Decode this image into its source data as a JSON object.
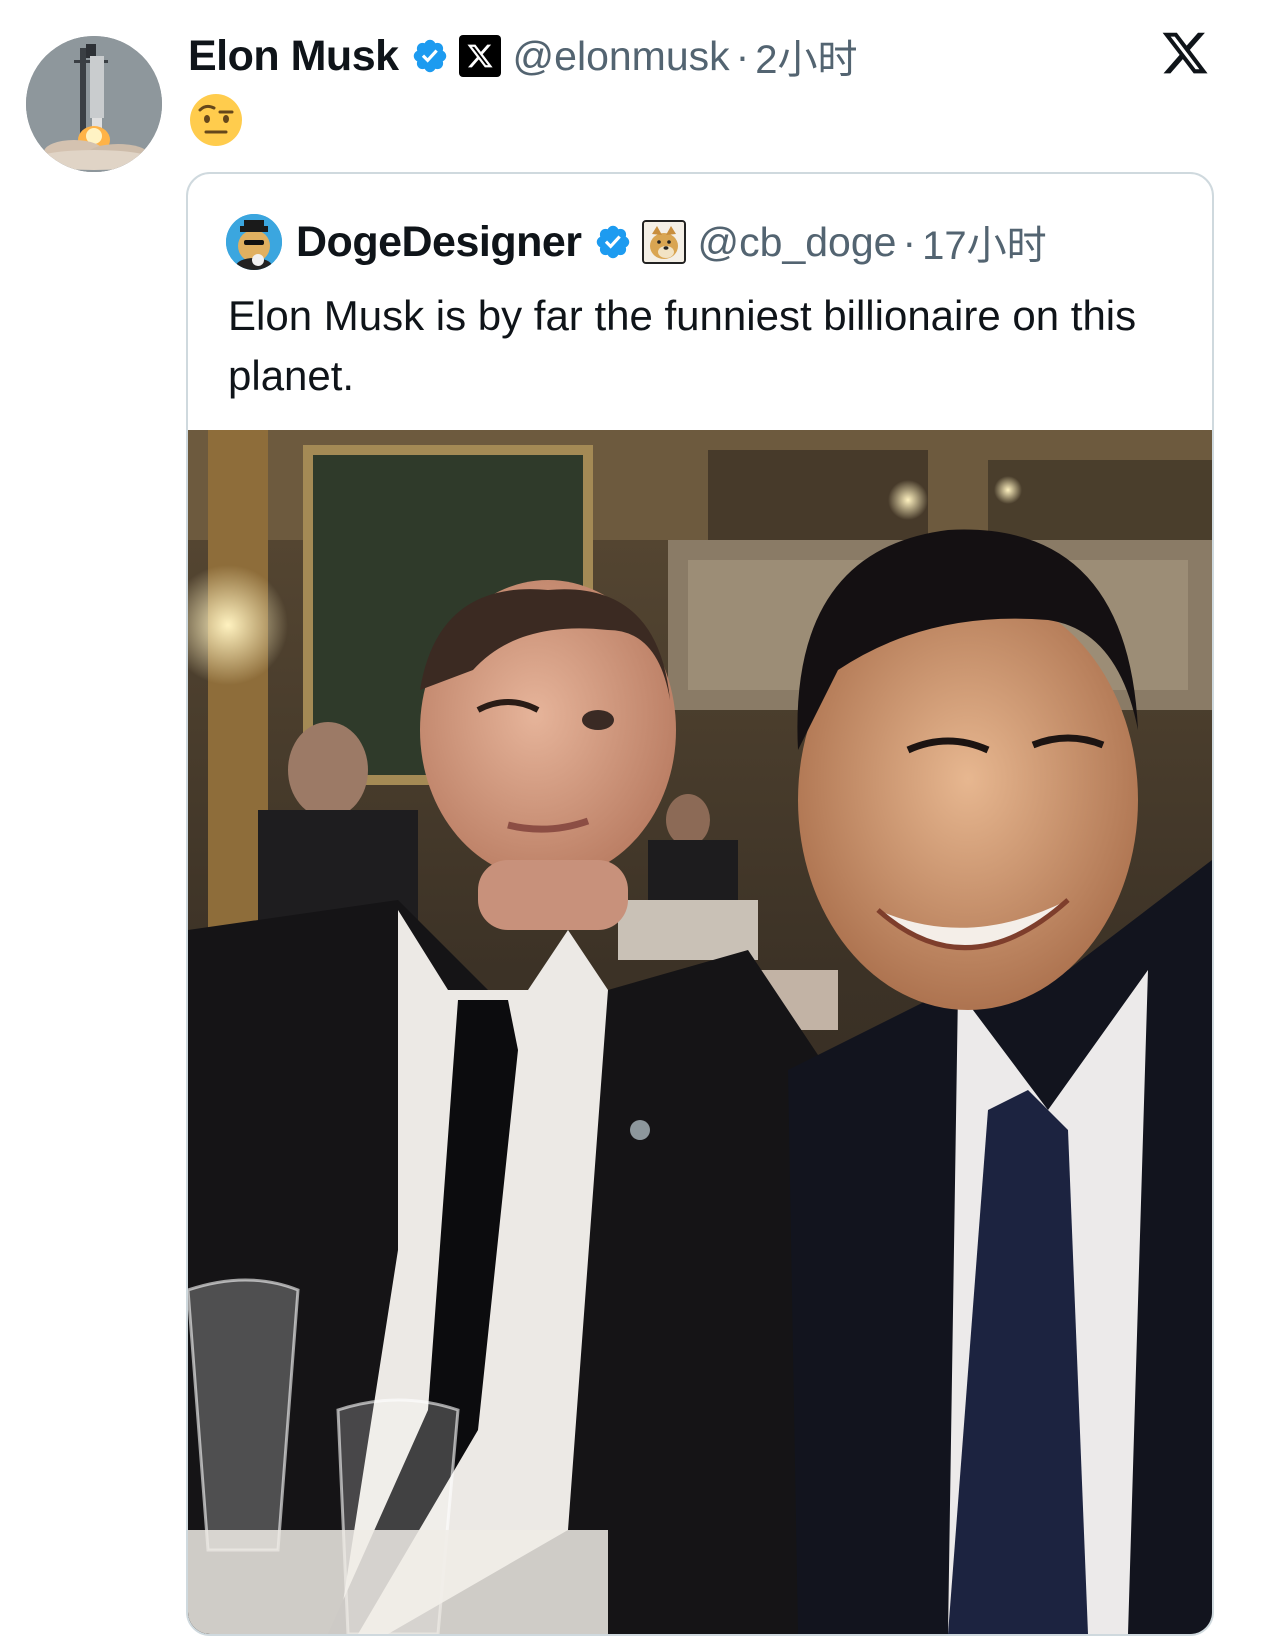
{
  "post": {
    "author_name": "Elon Musk",
    "handle": "@elonmusk",
    "separator": "·",
    "time": "2小时",
    "text": "🤨"
  },
  "quoted": {
    "author_name": "DogeDesigner",
    "handle": "@cb_doge",
    "separator": "·",
    "time": "17小时",
    "text": "Elon Musk is by far the funniest billionaire on this planet."
  },
  "icons": {
    "verified": "verified-badge-icon",
    "affiliate": "x-affiliate-icon",
    "doge_affiliate": "doge-affiliate-icon",
    "brand": "x-logo-icon"
  },
  "colors": {
    "verified_blue": "#1d9bf0",
    "secondary_text": "#536471",
    "border": "#cfd9de"
  }
}
